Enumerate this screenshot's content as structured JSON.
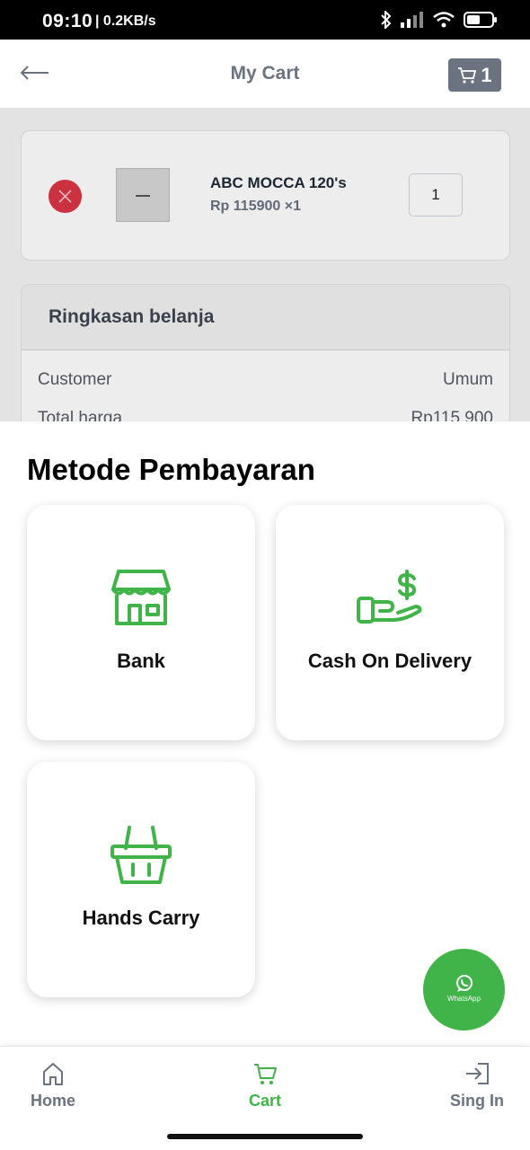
{
  "status_bar": {
    "time": "09:10",
    "network_speed": "| 0.2KB/s"
  },
  "header": {
    "title": "My Cart",
    "cart_count": "1"
  },
  "cart_item": {
    "name": "ABC MOCCA 120's",
    "price": "Rp 115900 ×1",
    "quantity": "1"
  },
  "summary": {
    "title": "Ringkasan belanja",
    "rows": [
      {
        "label": "Customer",
        "value": "Umum"
      },
      {
        "label": "Total harga",
        "value": "Rp115.900"
      }
    ]
  },
  "payment_sheet": {
    "title": "Metode Pembayaran",
    "methods": [
      {
        "label": "Bank",
        "icon": "store-icon"
      },
      {
        "label": "Cash On Delivery",
        "icon": "cash-hand-icon"
      },
      {
        "label": "Hands Carry",
        "icon": "basket-icon"
      }
    ]
  },
  "whatsapp": {
    "label": "WhatsApp"
  },
  "bottom_nav": {
    "items": [
      {
        "label": "Home",
        "icon": "home-icon",
        "color": "#6b7280"
      },
      {
        "label": "Cart",
        "icon": "cart-icon",
        "color": "#40b449"
      },
      {
        "label": "Sing In",
        "icon": "sign-in-icon",
        "color": "#6b7280"
      }
    ]
  },
  "colors": {
    "accent": "#40b449",
    "remove": "#dc3545",
    "muted": "#6b7280"
  }
}
